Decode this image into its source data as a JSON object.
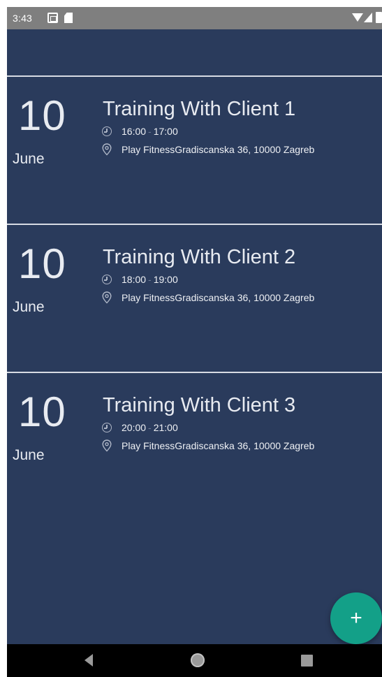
{
  "status_bar": {
    "time": "3:43",
    "icons": [
      "calendar-icon",
      "sd-card-icon",
      "wifi-icon",
      "signal-icon",
      "battery-icon"
    ]
  },
  "events": [
    {
      "day": "10",
      "month": "June",
      "title": "Training With Client 1",
      "start": "16:00",
      "end": "17:00",
      "location": "Play FitnessGradiscanska 36, 10000 Zagreb"
    },
    {
      "day": "10",
      "month": "June",
      "title": "Training With Client 2",
      "start": "18:00",
      "end": "19:00",
      "location": "Play FitnessGradiscanska 36, 10000 Zagreb"
    },
    {
      "day": "10",
      "month": "June",
      "title": "Training With Client 3",
      "start": "20:00",
      "end": "21:00",
      "location": "Play FitnessGradiscanska 36, 10000 Zagreb"
    }
  ],
  "fab": {
    "label": "+"
  },
  "colors": {
    "background": "#2a3b5c",
    "accent": "#13a088",
    "status_bar": "#7f7f7f",
    "nav_bar": "#000000"
  }
}
